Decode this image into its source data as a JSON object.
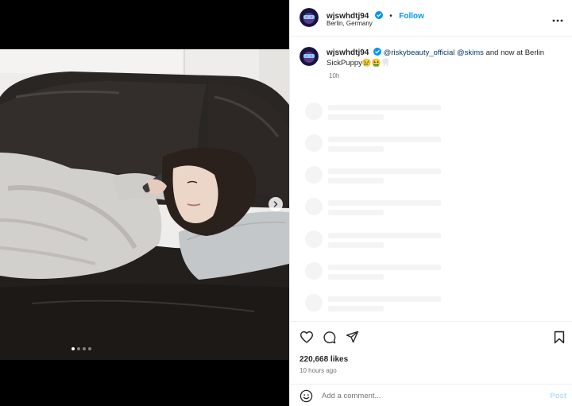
{
  "post": {
    "username": "wjswhdtj94",
    "follow_label": "Follow",
    "separator": "•",
    "location": "Berlin, Germany",
    "media_slide_index": 1,
    "media_slide_count": 4
  },
  "caption": {
    "username": "wjswhdtj94",
    "mention_1": "@riskybeauty_official",
    "mention_2": "@skims",
    "text": "and now at Berlin SickPuppy",
    "emojis": "😢🤮🦷",
    "time": "10h"
  },
  "engagement": {
    "likes": "220,668 likes",
    "time_ago": "10 hours ago"
  },
  "comment_box": {
    "placeholder": "Add a comment...",
    "post_label": "Post"
  },
  "icons": {
    "avatar": "avatar-image",
    "verified": "verified-badge-icon",
    "more": "more-options-icon",
    "next": "chevron-right-icon",
    "like": "heart-icon",
    "comment": "comment-bubble-icon",
    "share": "paper-plane-icon",
    "save": "bookmark-icon",
    "emoji": "smiley-icon"
  },
  "colors": {
    "accent": "#0095f6",
    "mention": "#00376b",
    "muted": "#737373",
    "post_disabled": "#b2dffc"
  }
}
